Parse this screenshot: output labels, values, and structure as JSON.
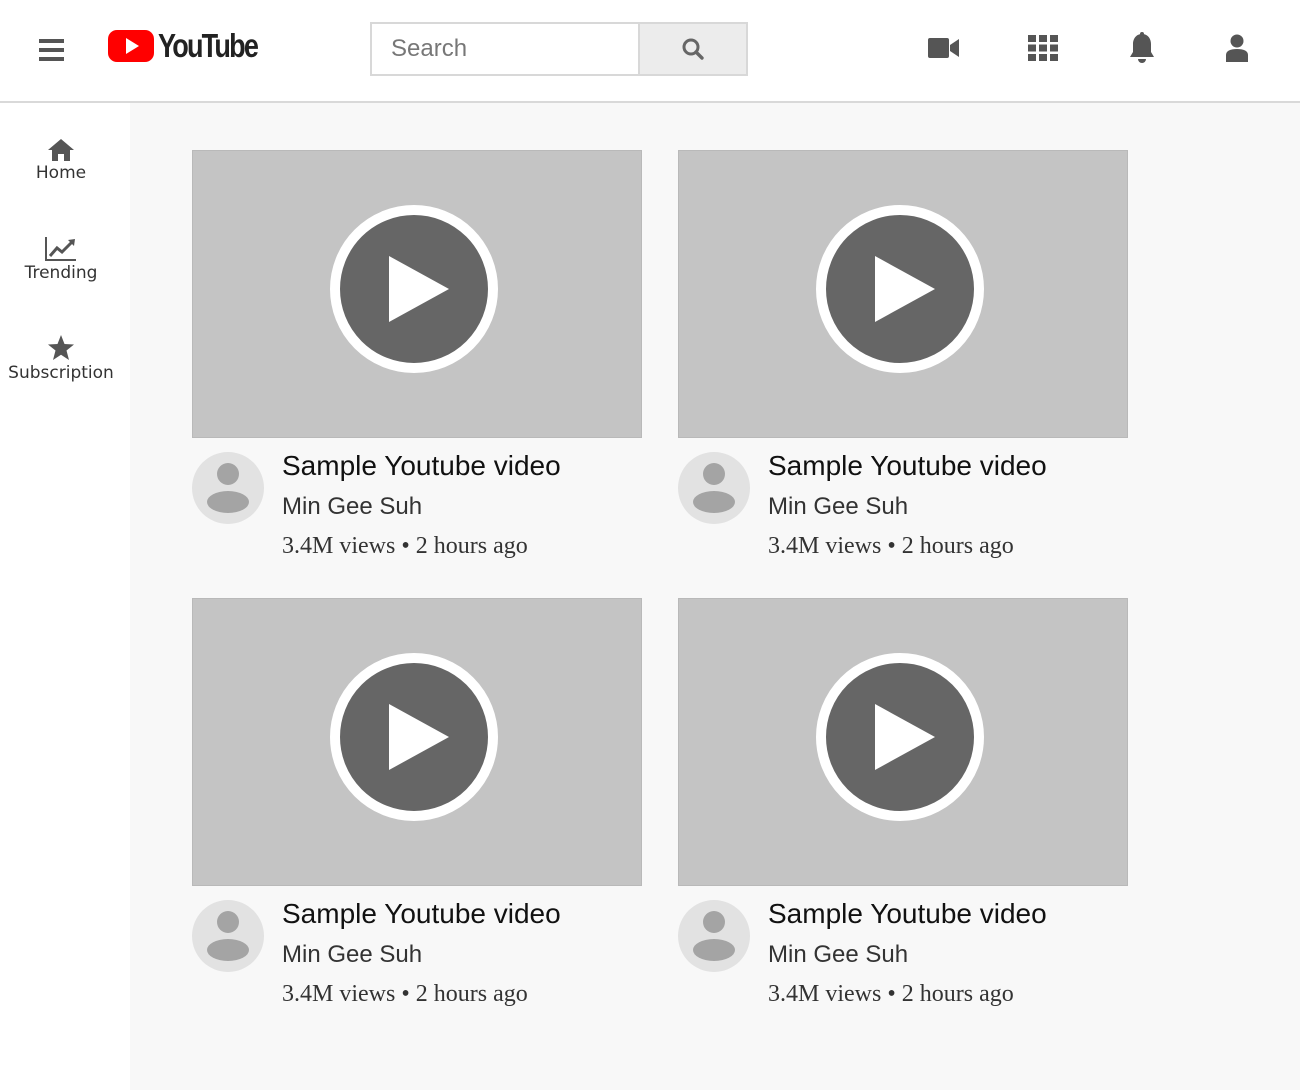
{
  "header": {
    "logo_text": "YouTube",
    "search_placeholder": "Search"
  },
  "icons": {
    "menu": "hamburger-menu-icon",
    "search": "search-icon",
    "upload": "video-camera-icon",
    "apps": "apps-grid-icon",
    "notifications": "bell-icon",
    "account": "user-icon"
  },
  "colors": {
    "brand_red": "#ff0000",
    "thumbnail_bg": "#c4c4c4",
    "play_button": "#666666",
    "icon_gray": "#555555"
  },
  "sidebar": {
    "items": [
      {
        "label": "Home",
        "icon": "home-icon"
      },
      {
        "label": "Trending",
        "icon": "trending-chart-icon"
      },
      {
        "label": "Subscription",
        "icon": "star-icon"
      }
    ]
  },
  "videos": [
    {
      "title": "Sample Youtube video",
      "channel": "Min Gee Suh",
      "meta": "3.4M views • 2 hours ago"
    },
    {
      "title": "Sample Youtube video",
      "channel": "Min Gee Suh",
      "meta": "3.4M views • 2 hours ago"
    },
    {
      "title": "Sample Youtube video",
      "channel": "Min Gee Suh",
      "meta": "3.4M views • 2 hours ago"
    },
    {
      "title": "Sample Youtube video",
      "channel": "Min Gee Suh",
      "meta": "3.4M views • 2 hours ago"
    }
  ]
}
